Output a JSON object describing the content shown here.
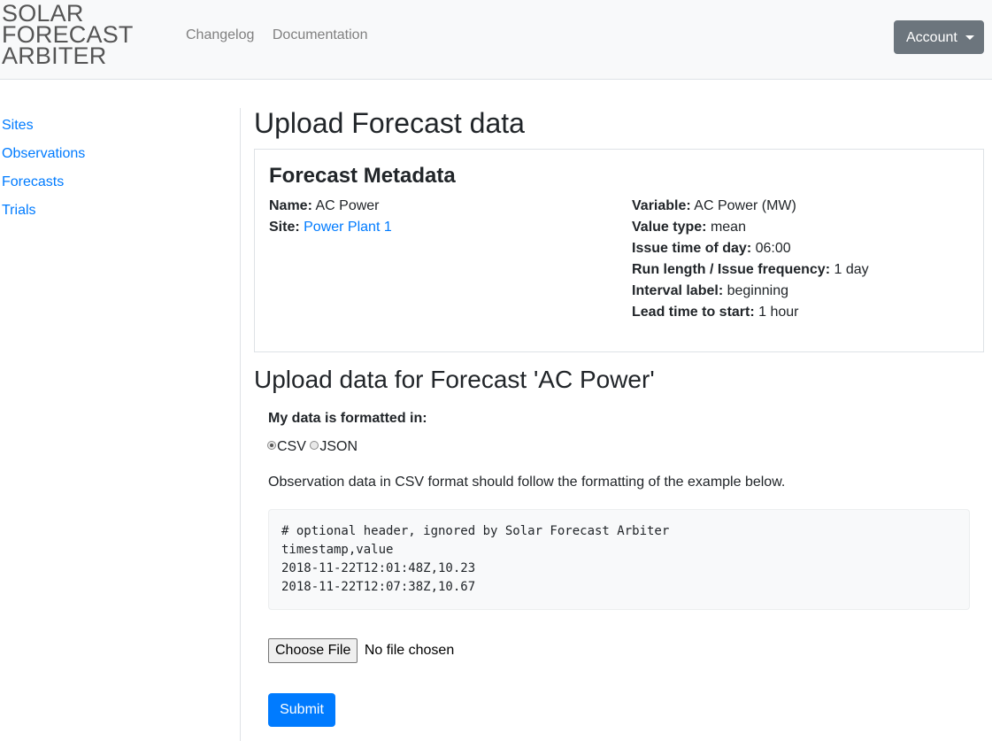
{
  "brand": "SOLAR FORECAST ARBITER",
  "nav": {
    "links": [
      "Changelog",
      "Documentation"
    ],
    "account_label": "Account"
  },
  "sidebar": {
    "items": [
      "Sites",
      "Observations",
      "Forecasts",
      "Trials"
    ]
  },
  "page_title": "Upload Forecast data",
  "metadata": {
    "heading": "Forecast Metadata",
    "name_label": "Name:",
    "name": "AC Power",
    "site_label": "Site:",
    "site": "Power Plant 1",
    "variable_label": "Variable:",
    "variable": "AC Power (MW)",
    "value_type_label": "Value type:",
    "value_type": "mean",
    "issue_time_label": "Issue time of day:",
    "issue_time": "06:00",
    "run_length_label": "Run length / Issue frequency:",
    "run_length": "1 day",
    "interval_label_label": "Interval label:",
    "interval_label": "beginning",
    "lead_time_label": "Lead time to start:",
    "lead_time": "1 hour"
  },
  "upload": {
    "heading": "Upload data for Forecast 'AC Power'",
    "format_label": "My data is formatted in:",
    "formats": [
      {
        "label": "CSV",
        "checked": true
      },
      {
        "label": "JSON",
        "checked": false
      }
    ],
    "help_text": "Observation data in CSV format should follow the formatting of the example below.",
    "example_lines": [
      "# optional header, ignored by Solar Forecast Arbiter",
      "timestamp,value",
      "2018-11-22T12:01:48Z,10.23",
      "2018-11-22T12:07:38Z,10.67"
    ],
    "choose_file_label": "Choose File",
    "file_status": "No file chosen",
    "submit_label": "Submit"
  },
  "colors": {
    "link": "#007bff",
    "primary": "#007bff",
    "secondary": "#6c757d",
    "navbar_bg": "#f8f9fa"
  }
}
